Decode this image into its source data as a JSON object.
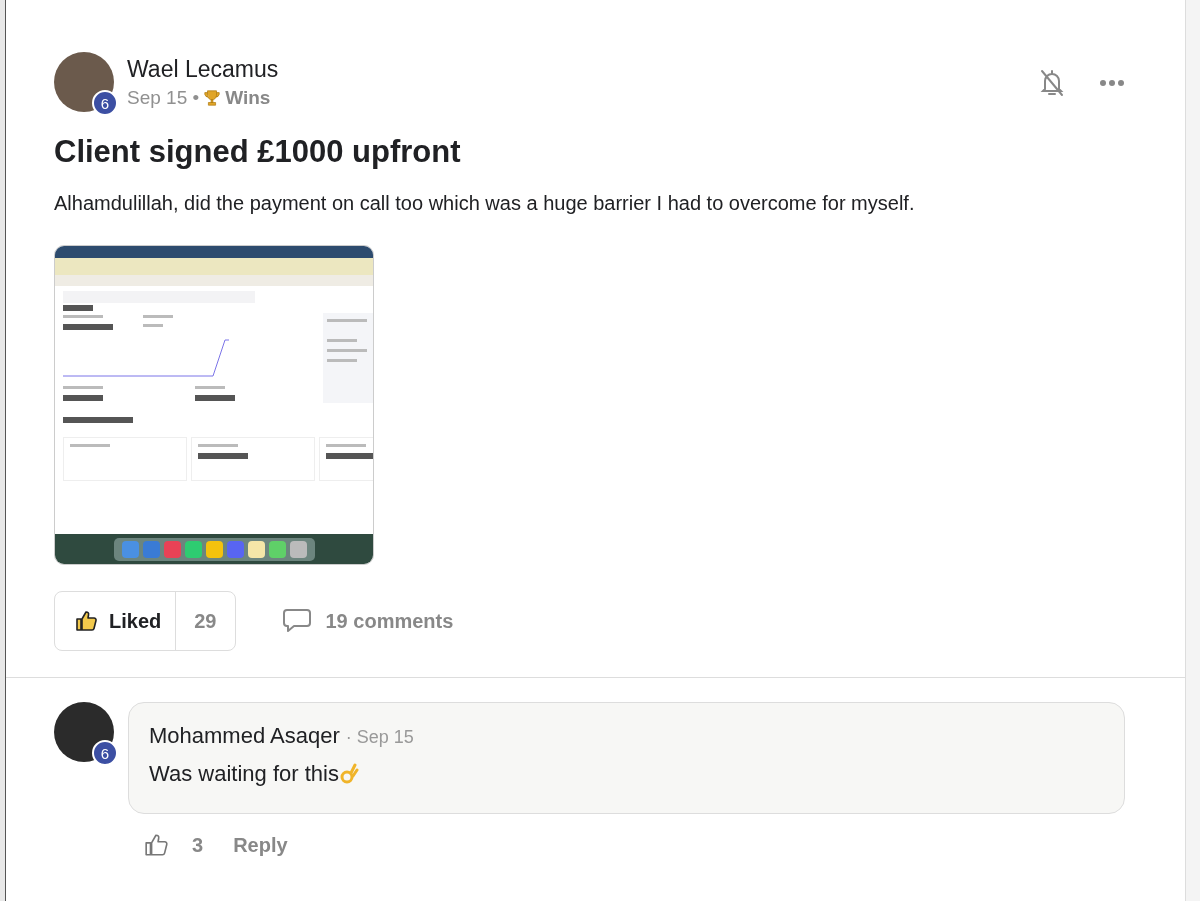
{
  "post": {
    "author": {
      "name": "Wael Lecamus",
      "level": "6"
    },
    "date": "Sep 15 •",
    "category": "Wins",
    "title": "Client signed £1000 upfront",
    "body": "Alhamdulillah, did the payment on call too which was a huge barrier I had to overcome for myself.",
    "like": {
      "label": "Liked",
      "liked": true,
      "count": "29"
    },
    "comments_count": "19 comments"
  },
  "comments": [
    {
      "author": "Mohammed Asaqer",
      "level": "6",
      "date": "· Sep 15",
      "text": "Was waiting for this",
      "liked": false,
      "likes": "3",
      "reply": "Reply"
    }
  ]
}
